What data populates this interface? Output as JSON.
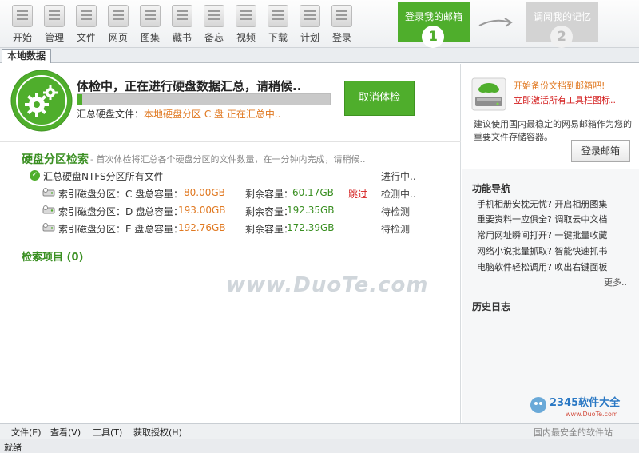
{
  "toolbar": {
    "items": [
      {
        "label": "开始",
        "icon": "home-icon"
      },
      {
        "label": "管理",
        "icon": "manage-icon"
      },
      {
        "label": "文件",
        "icon": "file-icon"
      },
      {
        "label": "网页",
        "icon": "webpage-icon"
      },
      {
        "label": "图集",
        "icon": "gallery-icon"
      },
      {
        "label": "藏书",
        "icon": "books-icon"
      },
      {
        "label": "备忘",
        "icon": "memo-icon"
      },
      {
        "label": "视频",
        "icon": "video-icon"
      },
      {
        "label": "下载",
        "icon": "download-icon"
      },
      {
        "label": "计划",
        "icon": "plan-icon"
      },
      {
        "label": "登录",
        "icon": "login-icon"
      }
    ]
  },
  "steps": {
    "step1": {
      "label": "登录我的邮箱",
      "num": "1",
      "color": "#4fae2c"
    },
    "step2": {
      "label": "调阅我的记忆",
      "num": "2"
    }
  },
  "tabs": {
    "active": "本地数据"
  },
  "scan": {
    "title": "体检中，正在进行硬盘数据汇总，请稍候..",
    "progress_fraction": 0.02,
    "file_label": "汇总硬盘文件：",
    "file_value": "本地硬盘分区 C 盘 正在汇总中..",
    "cancel_label": "取消体检"
  },
  "disk_section": {
    "title": "硬盘分区检索",
    "description": "- 首次体检将汇总各个硬盘分区的文件数量，在一分钟内完成，请稍候..",
    "summary": {
      "label": "汇总硬盘NTFS分区所有文件",
      "status": "进行中.."
    },
    "rows": [
      {
        "name": "索引磁盘分区：C 盘",
        "total_label": "总容量：",
        "total": "80.00GB",
        "free_label": "剩余容量：",
        "free": "60.17GB",
        "skip": "跳过",
        "status": "检测中.."
      },
      {
        "name": "索引磁盘分区：D 盘",
        "total_label": "总容量：",
        "total": "193.00GB",
        "free_label": "剩余容量：",
        "free": "192.35GB",
        "skip": "",
        "status": "待检测"
      },
      {
        "name": "索引磁盘分区：E 盘",
        "total_label": "总容量：",
        "total": "192.76GB",
        "free_label": "剩余容量：",
        "free": "172.39GB",
        "skip": "",
        "status": "待检测"
      }
    ]
  },
  "items_section": {
    "title": "检索项目 (0)"
  },
  "watermark": "www.DuoTe.com",
  "mail_panel": {
    "line1": "开始备份文档到邮箱吧!",
    "line2": "立即激活所有工具栏图标..",
    "description": "建议使用国内最稳定的网易邮箱作为您的重要文件存储容器。",
    "button": "登录邮箱"
  },
  "nav": {
    "title": "功能导航",
    "rows": [
      {
        "left": "手机相册安枕无忧?",
        "right": "开启相册图集"
      },
      {
        "left": "重要资料一应俱全?",
        "right": "调取云中文档"
      },
      {
        "left": "常用网址瞬间打开?",
        "right": "一键批量收藏"
      },
      {
        "left": "网络小说批量抓取?",
        "right": "智能快速抓书"
      },
      {
        "left": "电脑软件轻松调用?",
        "right": "唤出右键面板"
      }
    ],
    "more": "更多.."
  },
  "history": {
    "title": "历史日志"
  },
  "brand": {
    "name": "2345软件大全",
    "url": "www.DuoTe.com"
  },
  "menubar": {
    "items": [
      "文件(E)",
      "查看(V)",
      "工具(T)",
      "获取授权(H)"
    ],
    "slogan": "国内最安全的软件站"
  },
  "statusbar": {
    "text": "就绪"
  }
}
